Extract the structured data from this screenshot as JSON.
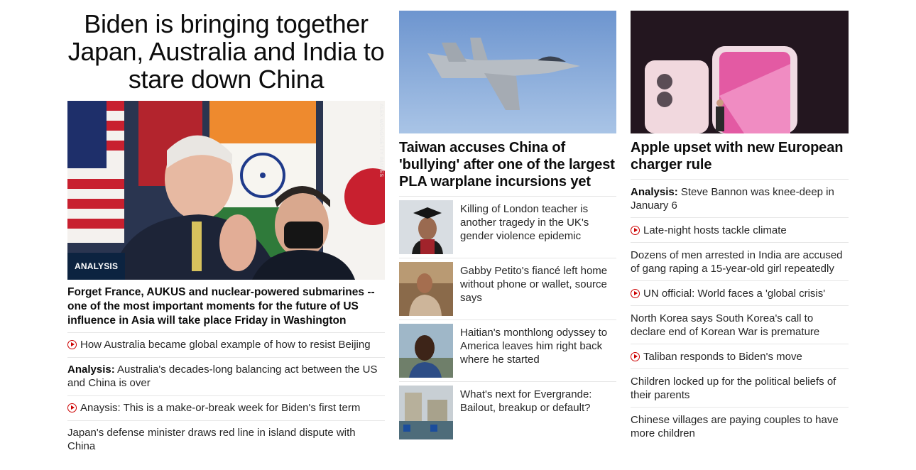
{
  "main": {
    "headline": "Biden is bringing together Japan, Australia and India to stare down China",
    "badge": "ANALYSIS",
    "photo_credit": "ALEX WONG/GETTY IMAGES",
    "lede": "Forget France, AUKUS and nuclear-powered submarines -- one of the most important moments for the future of US influence in Asia will take place Friday in Washington",
    "items": [
      {
        "prefix": "",
        "text": "How Australia became global example of how to resist Beijing",
        "video": true
      },
      {
        "prefix": "Analysis:",
        "text": " Australia's decades-long balancing act between the US and China is over",
        "video": false
      },
      {
        "prefix": "",
        "text": "Anaysis: This is a make-or-break week for Biden's first term",
        "video": true
      },
      {
        "prefix": "",
        "text": "Japan's defense minister draws red line in island dispute with China",
        "video": false
      }
    ]
  },
  "middle": {
    "headline": "Taiwan accuses China of 'bullying' after one of the largest PLA warplane incursions yet",
    "rows": [
      {
        "text": "Killing of London teacher is another tragedy in the UK's gender violence epidemic"
      },
      {
        "text": "Gabby Petito's fiancé left home without phone or wallet, source says"
      },
      {
        "text": "Haitian's monthlong odyssey to America leaves him right back where he started"
      },
      {
        "text": "What's next for Evergrande: Bailout, breakup or default?"
      }
    ]
  },
  "right": {
    "headline": "Apple upset with new European charger rule",
    "items": [
      {
        "prefix": "Analysis:",
        "text": " Steve Bannon was knee-deep in January 6",
        "video": false
      },
      {
        "prefix": "",
        "text": "Late-night hosts tackle climate",
        "video": true
      },
      {
        "prefix": "",
        "text": "Dozens of men arrested in India are accused of gang raping a 15-year-old girl repeatedly",
        "video": false
      },
      {
        "prefix": "",
        "text": "UN official: World faces a 'global crisis'",
        "video": true
      },
      {
        "prefix": "",
        "text": "North Korea says South Korea's call to declare end of Korean War is premature",
        "video": false
      },
      {
        "prefix": "",
        "text": "Taliban responds to Biden's move",
        "video": true
      },
      {
        "prefix": "",
        "text": "Children locked up for the political beliefs of their parents",
        "video": false
      },
      {
        "prefix": "",
        "text": "Chinese villages are paying couples to have more children",
        "video": false
      }
    ]
  },
  "colors": {
    "accent_red": "#cc0000",
    "badge_bg": "#0c2340",
    "divider": "#e6e6e6"
  }
}
